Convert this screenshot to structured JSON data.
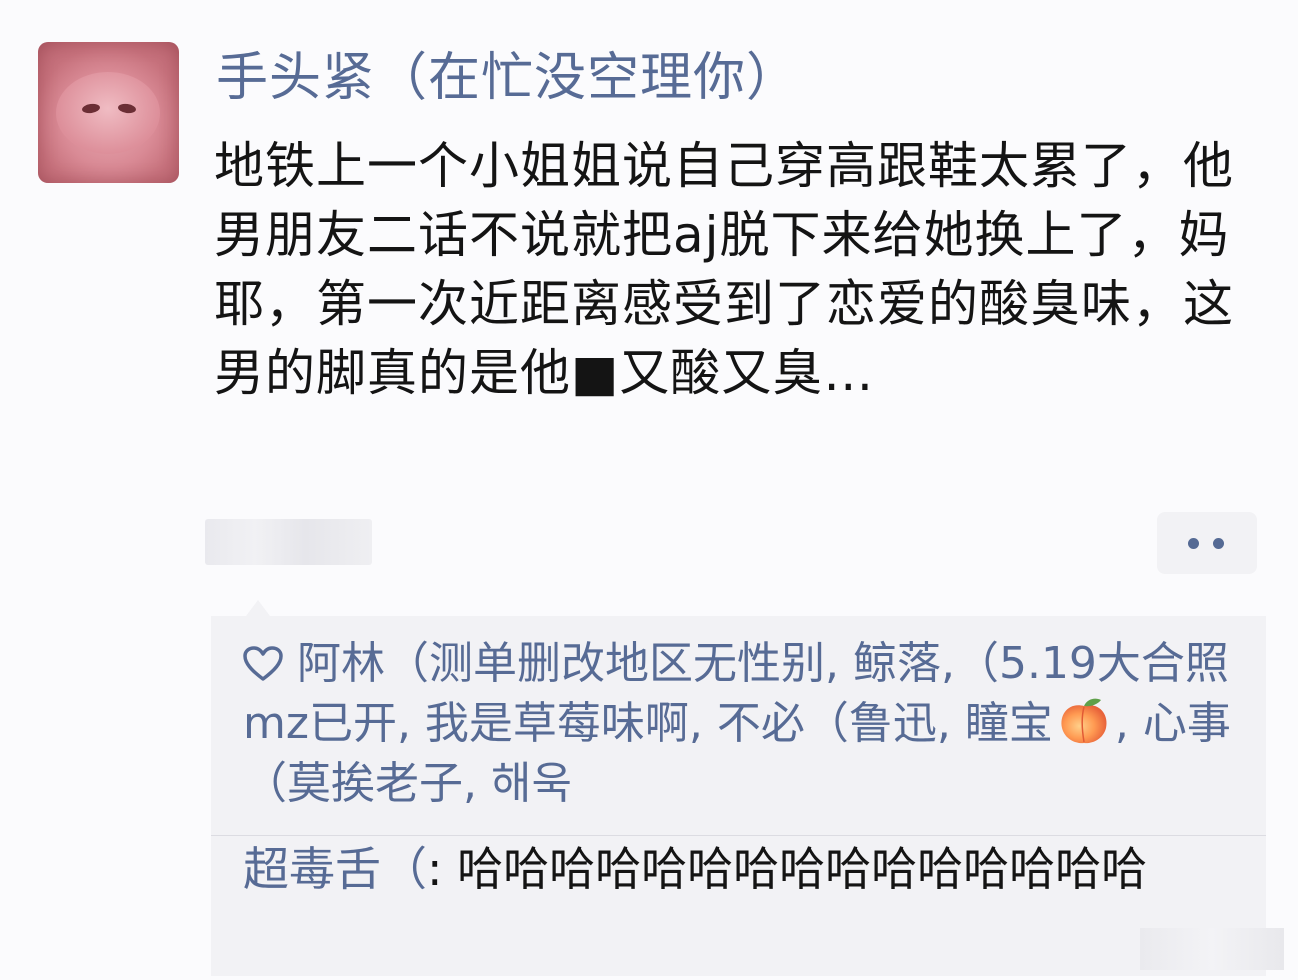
{
  "post": {
    "username": "手头紧（在忙没空理你）",
    "text": "地铁上一个小姐姐说自己穿高跟鞋太累了，他男朋友二话不说就把aj脱下来给她换上了，妈耶，第一次近距离感受到了恋爱的酸臭味，这男的脚真的是他■又酸又臭…",
    "more_icon": "ellipsis-icon"
  },
  "likes": {
    "icon": "heart-outline-icon",
    "text_before_emoji": "阿林（测单删改地区无性别, 鲸落,（5.19大合照 mz已开, 我是草莓味啊, 不必（鲁迅, 瞳宝",
    "emoji": "peach-emoji",
    "text_after_emoji": ", 心事（莫挨老子, 해욱"
  },
  "comment": {
    "author": "超毒舌（",
    "separator": ": ",
    "text": "哈哈哈哈哈哈哈哈哈哈哈哈哈哈哈"
  },
  "colors": {
    "link_blue": "#576b95",
    "comment_bg": "#f2f2f5"
  }
}
